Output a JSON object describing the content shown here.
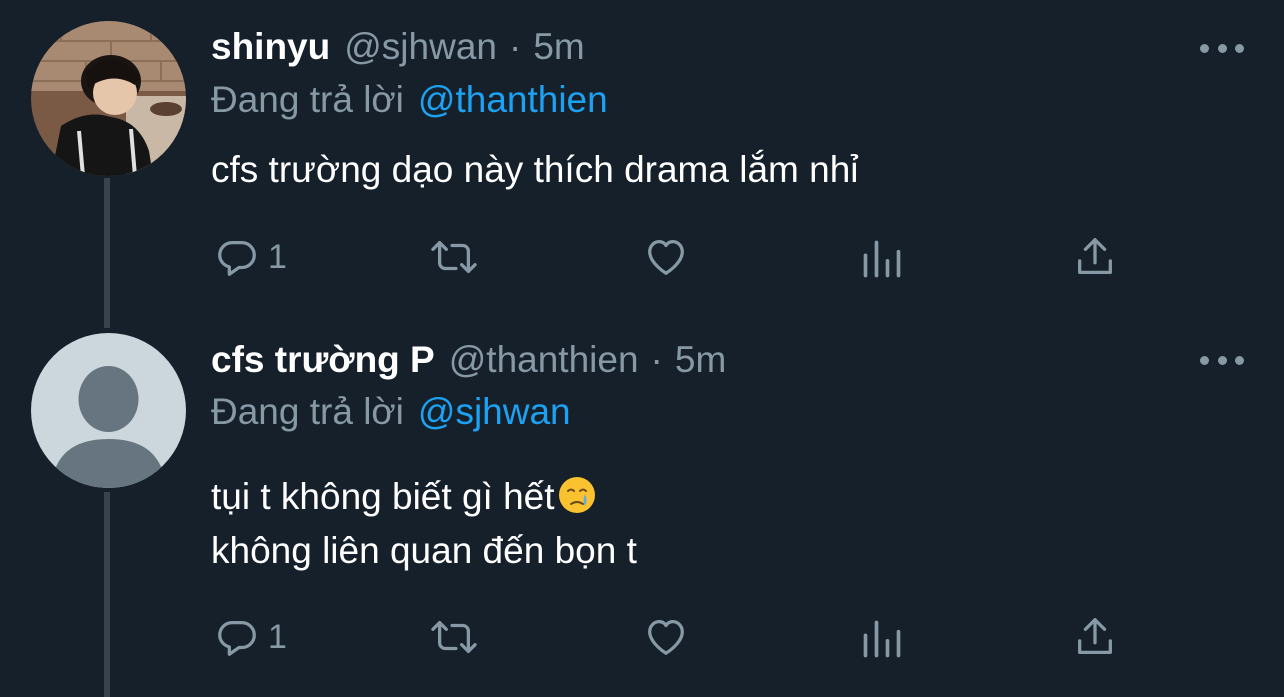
{
  "tweets": [
    {
      "display_name": "shinyu",
      "handle": "@sjhwan",
      "separator": "·",
      "time": "5m",
      "replying_label": "Đang trả lời",
      "replying_to": "@thanthien",
      "text_lines": [
        "cfs trường dạo này thích drama lắm nhỉ"
      ],
      "reply_count": "1",
      "avatar": "photo-avatar"
    },
    {
      "display_name": "cfs trường P",
      "handle": "@thanthien",
      "separator": "·",
      "time": "5m",
      "replying_label": "Đang trả lời",
      "replying_to": "@sjhwan",
      "text_lines": [
        "tụi t không biết gì hết",
        "không liên quan đến bọn t"
      ],
      "emoji": "crying-face",
      "reply_count": "1",
      "avatar": "default-avatar"
    }
  ],
  "icons": {
    "reply": "reply-icon",
    "retweet": "retweet-icon",
    "like": "heart-icon",
    "analytics": "analytics-icon",
    "share": "share-icon",
    "more": "more-icon"
  },
  "colors": {
    "background": "#15202b",
    "primary_text": "#ffffff",
    "secondary_text": "#8899a6",
    "accent": "#1da1f2",
    "thread_line": "#38444d"
  }
}
